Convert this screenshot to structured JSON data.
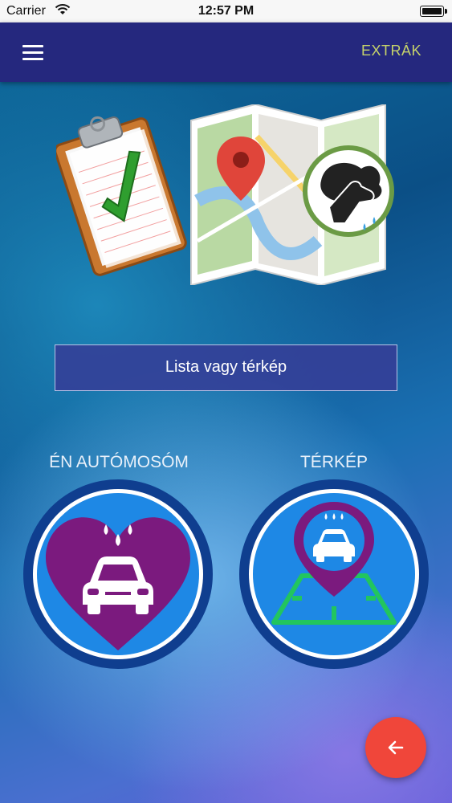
{
  "status_bar": {
    "carrier": "Carrier",
    "time": "12:57 PM"
  },
  "appbar": {
    "menu_icon": "hamburger-menu-icon",
    "extra_label": "EXTRÁK"
  },
  "main": {
    "list_or_map_button": "Lista vagy térkép",
    "my_carwash": {
      "label": "ÉN AUTÓMOSÓM",
      "icon": "heart-car-wash-icon"
    },
    "map": {
      "label": "TÉRKÉP",
      "icon": "map-pin-car-icon"
    }
  },
  "fab": {
    "icon": "arrow-left-icon"
  },
  "colors": {
    "appbar": "#25287e",
    "accent": "#c6d36a",
    "fab": "#f0463a",
    "circle_blue": "#1e88e5",
    "purple": "#7b1a7e",
    "green": "#22c55e"
  }
}
